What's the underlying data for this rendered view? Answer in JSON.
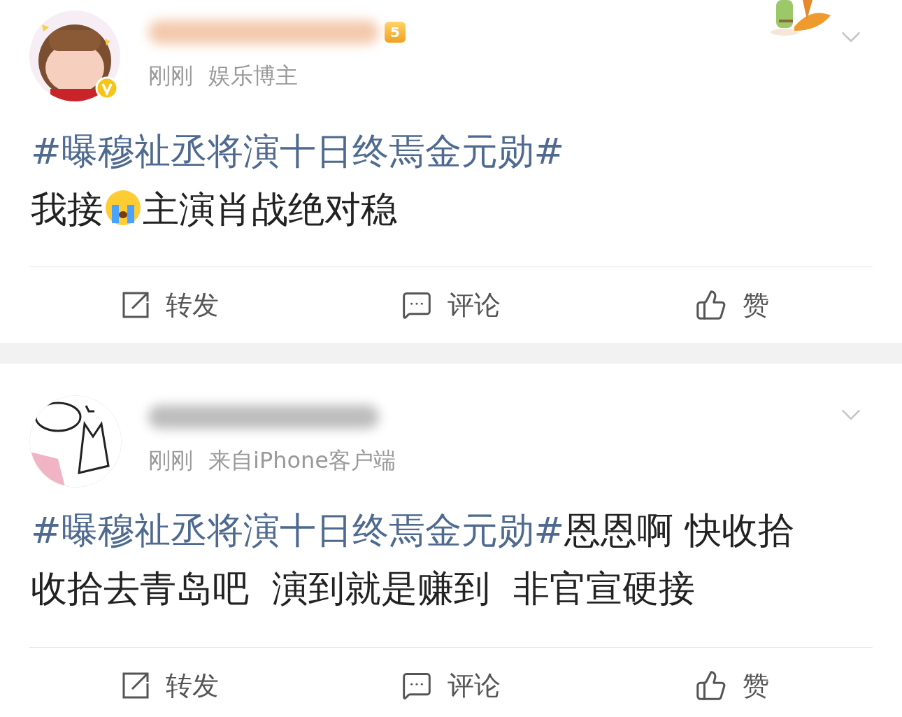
{
  "posts": [
    {
      "verified": true,
      "rank_badge": "5",
      "decoration": {
        "kind": "picture"
      },
      "time": "刚刚",
      "source": "娱乐博主",
      "paragraphs": [
        [
          {
            "kind": "hashtag",
            "text": "#曝穆祉丞将演十日终焉金元勋#"
          }
        ],
        [
          {
            "kind": "text",
            "text": "我接"
          },
          {
            "kind": "emoji"
          },
          {
            "kind": "text",
            "text": "主演肖战绝对稳"
          }
        ]
      ],
      "actions": [
        {
          "kind": "repost",
          "label": "转发"
        },
        {
          "kind": "comment",
          "label": "评论"
        },
        {
          "kind": "like",
          "label": "赞"
        }
      ]
    },
    {
      "verified": false,
      "time": "刚刚",
      "source": "来自iPhone客户端",
      "paragraphs": [
        [
          {
            "kind": "hashtag",
            "text": "#曝穆祉丞将演十日终焉金元勋#"
          },
          {
            "kind": "text",
            "text": "恩恩啊 快收拾收拾去青岛吧  演到就是赚到  非官宣硬接"
          }
        ]
      ],
      "actions": [
        {
          "kind": "repost",
          "label": "转发"
        },
        {
          "kind": "comment",
          "label": "评论"
        },
        {
          "kind": "like",
          "label": "赞"
        }
      ]
    }
  ]
}
